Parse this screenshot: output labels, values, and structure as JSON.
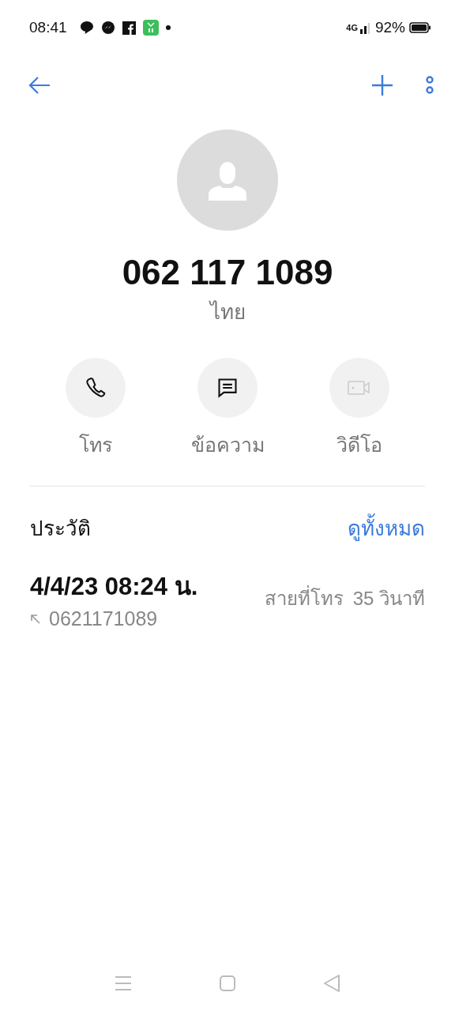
{
  "status_bar": {
    "time": "08:41",
    "network": "4G",
    "battery": "92%"
  },
  "contact": {
    "number": "062 117 1089",
    "location": "ไทย"
  },
  "actions": [
    {
      "kind": "call",
      "label": "โทร",
      "disabled": false
    },
    {
      "kind": "message",
      "label": "ข้อความ",
      "disabled": false
    },
    {
      "kind": "video",
      "label": "วิดีโอ",
      "disabled": true
    }
  ],
  "history": {
    "title": "ประวัติ",
    "link": "ดูทั้งหมด",
    "entries": [
      {
        "date": "4/4/23 08:24 น.",
        "outgoing": true,
        "number": "0621171089",
        "type": "สายที่โทร",
        "duration": "35 วินาที"
      }
    ]
  }
}
